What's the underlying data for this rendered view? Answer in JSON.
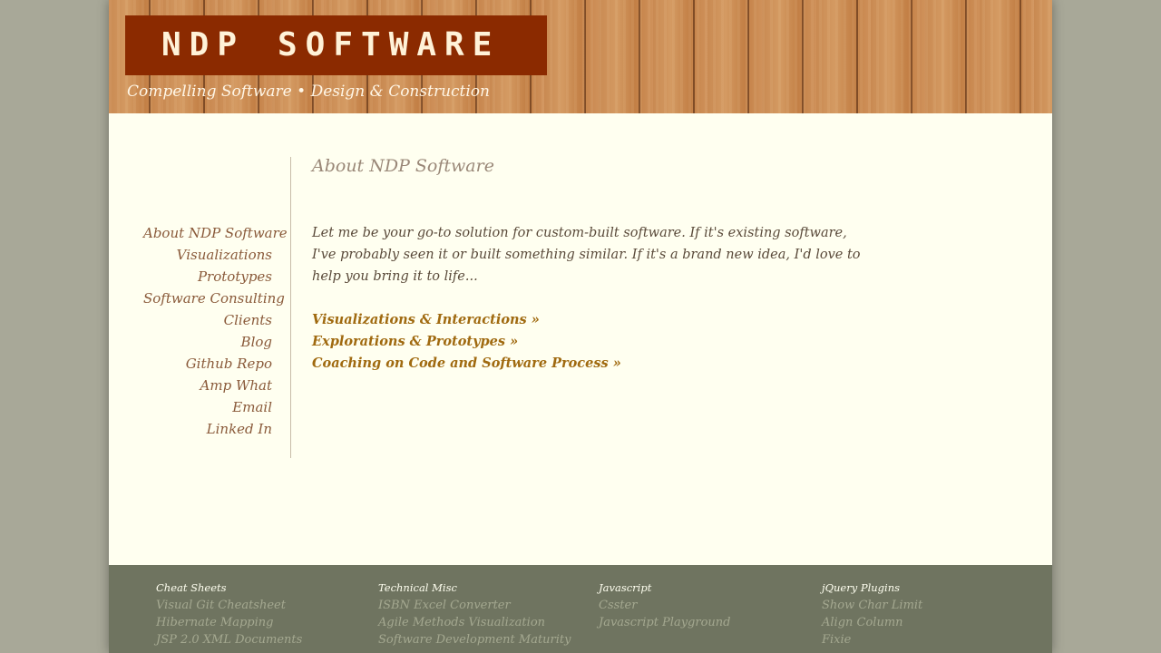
{
  "header": {
    "logo_ndp": "NDP",
    "logo_software": "SOFTWARE",
    "tagline_part1": "Compelling Software • Design",
    "tagline_part2": "& Construction"
  },
  "sidebar": {
    "items": [
      "About NDP Software",
      "Visualizations",
      "Prototypes",
      "Software Consulting",
      "Clients",
      "Blog",
      "Github Repo",
      "Amp What",
      "Email",
      "Linked In"
    ]
  },
  "main": {
    "title": "About NDP Software",
    "intro_lines": [
      "Let me be your go-to solution for custom-built software. If it's existing software,",
      "I've probably seen it or built something similar. If it's a brand new idea, I'd love to",
      "help you bring it to life..."
    ],
    "links": [
      "Visualizations & Interactions »",
      "Explorations & Prototypes »",
      "Coaching on Code and Software Process »"
    ]
  },
  "footer": {
    "columns": [
      {
        "heading": "Cheat Sheets",
        "links": [
          "Visual Git Cheatsheet",
          "Hibernate Mapping",
          "JSP 2.0 XML Documents"
        ]
      },
      {
        "heading": "Technical Misc",
        "links": [
          "ISBN Excel Converter",
          "Agile Methods Visualization",
          "Software Development Maturity"
        ]
      },
      {
        "heading": "Javascript",
        "links": [
          "Csster",
          "Javascript Playground"
        ]
      },
      {
        "heading": "jQuery Plugins",
        "links": [
          "Show Char Limit",
          "Align Column",
          "Fixie"
        ]
      }
    ]
  },
  "colors": {
    "logo_bg": "#8b2a00",
    "content_bg": "#fffff0",
    "footer_bg": "#6f7460",
    "link_accent": "#a06a10"
  }
}
